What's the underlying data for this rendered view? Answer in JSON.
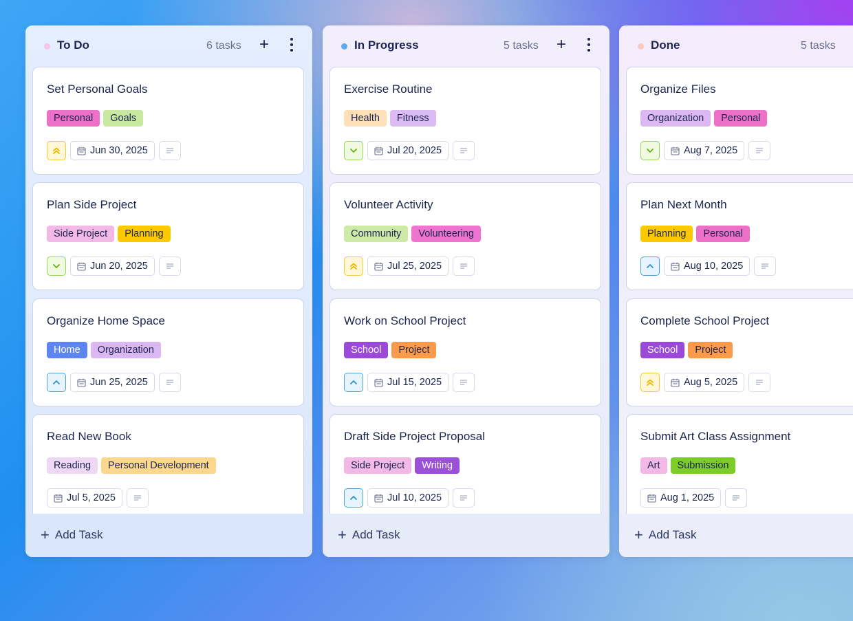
{
  "colors": {
    "text": "#1d2550",
    "muted": "#6a718f",
    "priority_high": "#f0b400",
    "priority_medium": "#2d8fd6",
    "priority_low": "#64b417"
  },
  "board": {
    "add_task_label": "Add Task",
    "columns": [
      {
        "title": "To Do",
        "count": "6 tasks",
        "dot_color": "#f4c4e6",
        "cards": [
          {
            "title": "Set Personal Goals",
            "tags": [
              {
                "label": "Personal",
                "bg": "#ec6fc8",
                "fg": "#1d2550"
              },
              {
                "label": "Goals",
                "bg": "#c9e9a1",
                "fg": "#1d2550"
              }
            ],
            "priority": "high",
            "priority_icon": "double-chevron-up-icon",
            "date": "Jun 30, 2025"
          },
          {
            "title": "Plan Side Project",
            "tags": [
              {
                "label": "Side Project",
                "bg": "#f2b8e6",
                "fg": "#1d2550"
              },
              {
                "label": "Planning",
                "bg": "#fcc800",
                "fg": "#1d2550"
              }
            ],
            "priority": "low",
            "priority_icon": "chevron-down-icon",
            "date": "Jun 20, 2025"
          },
          {
            "title": "Organize Home Space",
            "tags": [
              {
                "label": "Home",
                "bg": "#5e86f0",
                "fg": "#ffffff"
              },
              {
                "label": "Organization",
                "bg": "#dcb8f2",
                "fg": "#1d2550"
              }
            ],
            "priority": "medium",
            "priority_icon": "chevron-up-icon",
            "date": "Jun 25, 2025"
          },
          {
            "title": "Read New Book",
            "tags": [
              {
                "label": "Reading",
                "bg": "#eed8f3",
                "fg": "#1d2550"
              },
              {
                "label": "Personal Development",
                "bg": "#fbd88e",
                "fg": "#1d2550"
              }
            ],
            "priority": null,
            "priority_icon": null,
            "date": "Jul 5, 2025"
          }
        ]
      },
      {
        "title": "In Progress",
        "count": "5 tasks",
        "dot_color": "#5ea9ee",
        "cards": [
          {
            "title": "Exercise Routine",
            "tags": [
              {
                "label": "Health",
                "bg": "#fde0b8",
                "fg": "#1d2550"
              },
              {
                "label": "Fitness",
                "bg": "#dcbaf3",
                "fg": "#1d2550"
              }
            ],
            "priority": "low",
            "priority_icon": "chevron-down-icon",
            "date": "Jul 20, 2025"
          },
          {
            "title": "Volunteer Activity",
            "tags": [
              {
                "label": "Community",
                "bg": "#cfe9a7",
                "fg": "#1d2550"
              },
              {
                "label": "Volunteering",
                "bg": "#ee74cf",
                "fg": "#1d2550"
              }
            ],
            "priority": "high",
            "priority_icon": "double-chevron-up-icon",
            "date": "Jul 25, 2025"
          },
          {
            "title": "Work on School Project",
            "tags": [
              {
                "label": "School",
                "bg": "#9a4ad6",
                "fg": "#ffffff"
              },
              {
                "label": "Project",
                "bg": "#fa9a4c",
                "fg": "#1d2550"
              }
            ],
            "priority": "medium",
            "priority_icon": "chevron-up-icon",
            "date": "Jul 15, 2025"
          },
          {
            "title": "Draft Side Project Proposal",
            "tags": [
              {
                "label": "Side Project",
                "bg": "#f2b8e6",
                "fg": "#1d2550"
              },
              {
                "label": "Writing",
                "bg": "#9c4fd8",
                "fg": "#ffffff"
              }
            ],
            "priority": "medium",
            "priority_icon": "chevron-up-icon",
            "date": "Jul 10, 2025"
          }
        ]
      },
      {
        "title": "Done",
        "count": "5 tasks",
        "dot_color": "#f8c9c0",
        "cards": [
          {
            "title": "Organize Files",
            "tags": [
              {
                "label": "Organization",
                "bg": "#dcb8f2",
                "fg": "#1d2550"
              },
              {
                "label": "Personal",
                "bg": "#ec6fc8",
                "fg": "#1d2550"
              }
            ],
            "priority": "low",
            "priority_icon": "chevron-down-icon",
            "date": "Aug 7, 2025"
          },
          {
            "title": "Plan Next Month",
            "tags": [
              {
                "label": "Planning",
                "bg": "#fcc800",
                "fg": "#1d2550"
              },
              {
                "label": "Personal",
                "bg": "#ec6fc8",
                "fg": "#1d2550"
              }
            ],
            "priority": "medium",
            "priority_icon": "chevron-up-icon",
            "date": "Aug 10, 2025"
          },
          {
            "title": "Complete School Project",
            "tags": [
              {
                "label": "School",
                "bg": "#9a4ad6",
                "fg": "#ffffff"
              },
              {
                "label": "Project",
                "bg": "#fa9a4c",
                "fg": "#1d2550"
              }
            ],
            "priority": "high",
            "priority_icon": "double-chevron-up-icon",
            "date": "Aug 5, 2025"
          },
          {
            "title": "Submit Art Class Assignment",
            "tags": [
              {
                "label": "Art",
                "bg": "#f2b8e6",
                "fg": "#1d2550"
              },
              {
                "label": "Submission",
                "bg": "#7ccd2a",
                "fg": "#1d2550"
              }
            ],
            "priority": null,
            "priority_icon": null,
            "date": "Aug 1, 2025"
          }
        ]
      }
    ]
  }
}
